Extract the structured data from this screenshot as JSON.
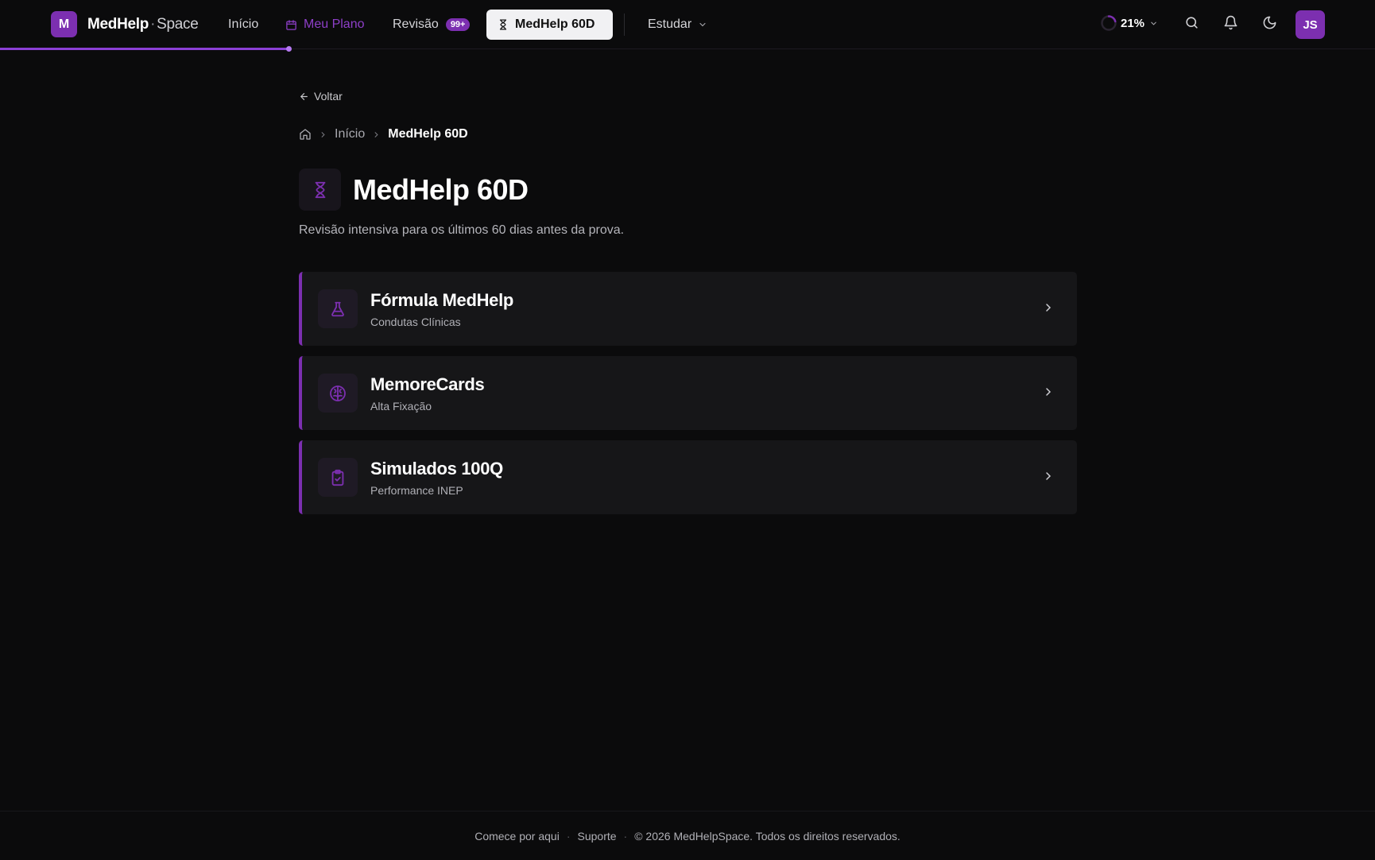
{
  "brand": {
    "logo_letter": "M",
    "name_bold": "MedHelp",
    "name_dot": "·",
    "name_light": "Space"
  },
  "nav": {
    "inicio": "Início",
    "meu_plano": "Meu Plano",
    "revisao": "Revisão",
    "revisao_badge": "99+",
    "medhelp60d": "MedHelp 60D",
    "estudar": "Estudar"
  },
  "header_right": {
    "progress_percent": "21%",
    "progress_value": 21,
    "avatar_initials": "JS"
  },
  "page_progress_fraction": 0.21,
  "back_label": "Voltar",
  "breadcrumb": {
    "home": "Início",
    "current": "MedHelp 60D"
  },
  "page": {
    "title": "MedHelp 60D",
    "subtitle": "Revisão intensiva para os últimos 60 dias antes da prova."
  },
  "cards": [
    {
      "title": "Fórmula MedHelp",
      "subtitle": "Condutas Clínicas",
      "icon": "flask-icon"
    },
    {
      "title": "MemoreCards",
      "subtitle": "Alta Fixação",
      "icon": "brain-icon"
    },
    {
      "title": "Simulados 100Q",
      "subtitle": "Performance INEP",
      "icon": "clipboard-check-icon"
    }
  ],
  "footer": {
    "start": "Comece por aqui",
    "support": "Suporte",
    "copyright": "© 2026 MedHelpSpace. Todos os direitos reservados."
  },
  "colors": {
    "accent": "#7c2fb0",
    "background": "#0b0b0c",
    "card": "#161618"
  }
}
